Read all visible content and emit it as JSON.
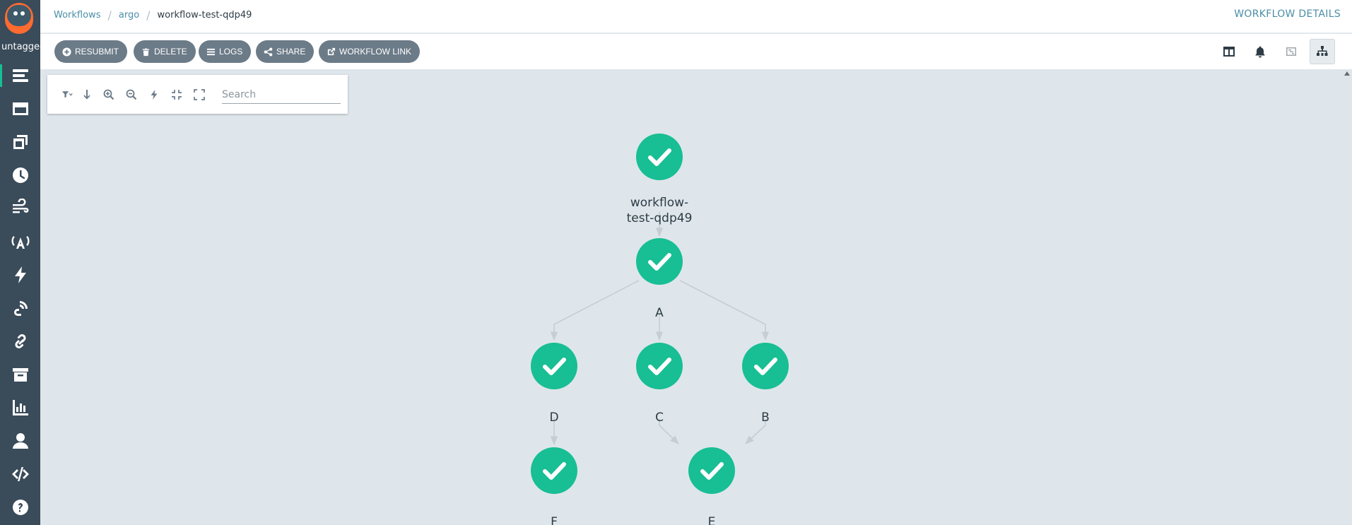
{
  "app": {
    "user_label": "untagged"
  },
  "breadcrumb": {
    "items": [
      "Workflows",
      "argo"
    ],
    "current": "workflow-test-qdp49"
  },
  "header": {
    "title": "WORKFLOW DETAILS"
  },
  "actions": [
    {
      "label": "RESUBMIT",
      "icon": "plus-circle-icon"
    },
    {
      "label": "DELETE",
      "icon": "trash-icon"
    },
    {
      "label": "LOGS",
      "icon": "bars-icon"
    },
    {
      "label": "SHARE",
      "icon": "share-icon"
    },
    {
      "label": "WORKFLOW LINK",
      "icon": "external-link-icon"
    }
  ],
  "graph": {
    "search_placeholder": "Search",
    "status_color": "#18be94",
    "nodes": [
      {
        "id": "root",
        "label_lines": [
          "workflow-",
          "test-qdp49"
        ],
        "status": "Succeeded"
      },
      {
        "id": "A",
        "label_lines": [
          "A"
        ],
        "status": "Succeeded"
      },
      {
        "id": "D",
        "label_lines": [
          "D"
        ],
        "status": "Succeeded"
      },
      {
        "id": "C",
        "label_lines": [
          "C"
        ],
        "status": "Succeeded"
      },
      {
        "id": "B",
        "label_lines": [
          "B"
        ],
        "status": "Succeeded"
      },
      {
        "id": "F",
        "label_lines": [
          "F"
        ],
        "status": "Succeeded"
      },
      {
        "id": "E",
        "label_lines": [
          "E"
        ],
        "status": "Succeeded"
      }
    ],
    "edges": [
      [
        "root",
        "A"
      ],
      [
        "A",
        "D"
      ],
      [
        "A",
        "C"
      ],
      [
        "A",
        "B"
      ],
      [
        "D",
        "F"
      ],
      [
        "C",
        "E"
      ],
      [
        "B",
        "E"
      ]
    ]
  }
}
